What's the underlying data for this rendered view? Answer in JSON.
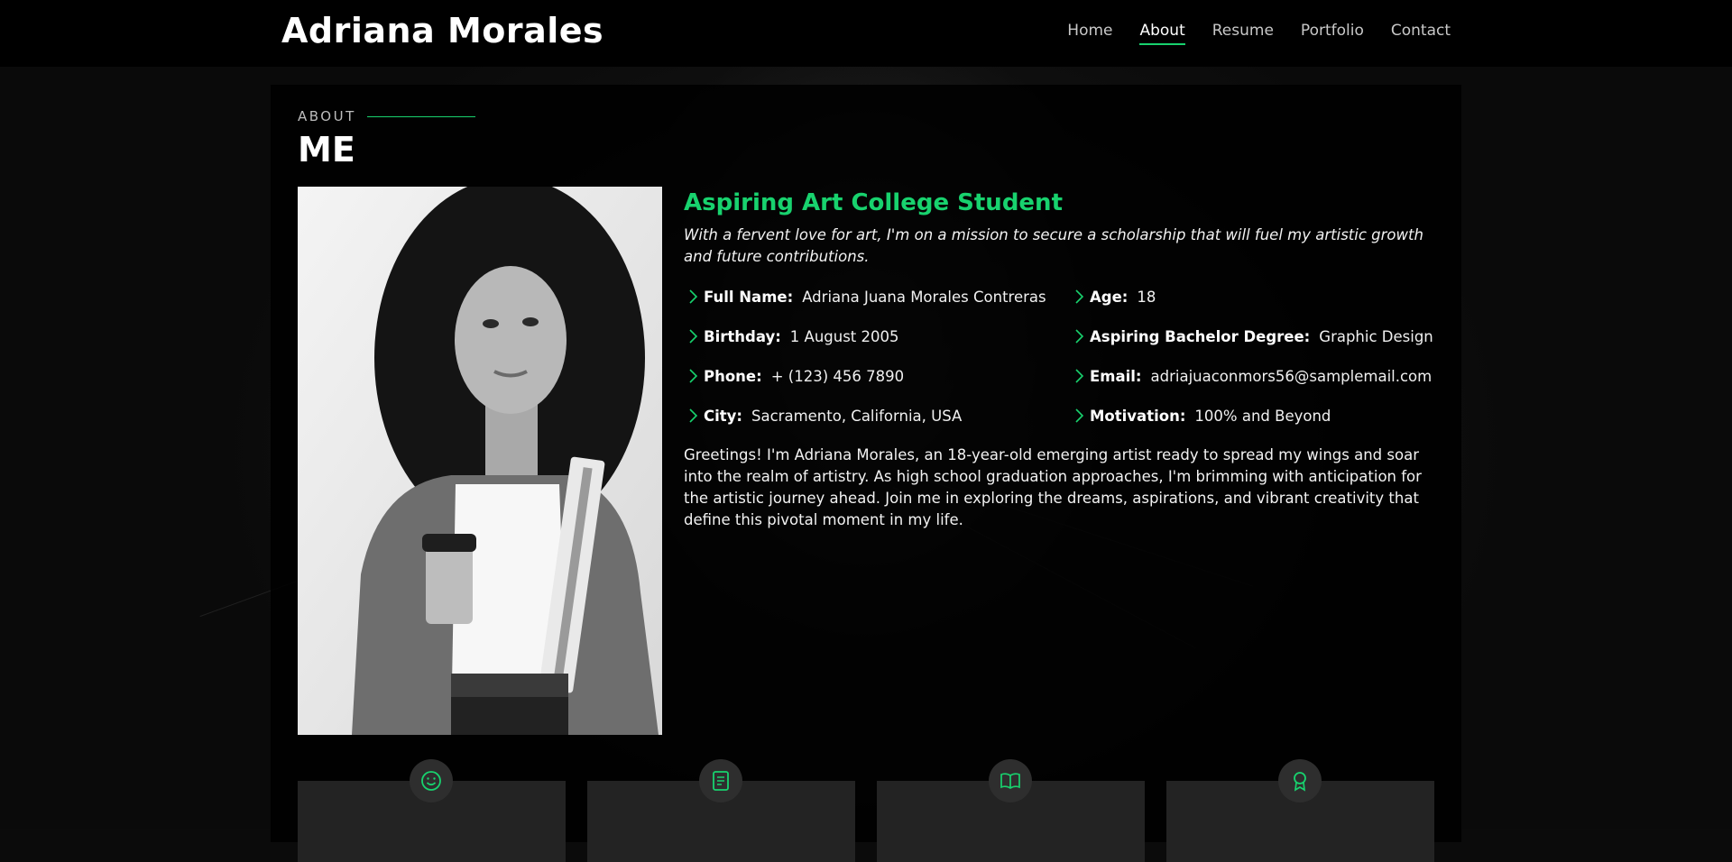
{
  "site": {
    "name": "Adriana Morales"
  },
  "nav": {
    "items": [
      {
        "label": "Home",
        "active": false
      },
      {
        "label": "About",
        "active": true
      },
      {
        "label": "Resume",
        "active": false
      },
      {
        "label": "Portfolio",
        "active": false
      },
      {
        "label": "Contact",
        "active": false
      }
    ]
  },
  "about": {
    "label": "ABOUT",
    "title": "ME",
    "heading": "Aspiring Art College Student",
    "intro": "With a fervent love for art, I'm on a mission to secure a scholarship that will fuel my artistic growth and future contributions.",
    "facts": [
      {
        "label": "Full Name:",
        "value": "Adriana Juana Morales Contreras"
      },
      {
        "label": "Age:",
        "value": "18"
      },
      {
        "label": "Birthday:",
        "value": "1 August 2005"
      },
      {
        "label": "Aspiring Bachelor Degree:",
        "value": "Graphic Design"
      },
      {
        "label": "Phone:",
        "value": "+ (123) 456 7890"
      },
      {
        "label": "Email:",
        "value": "adriajuaconmors56@samplemail.com"
      },
      {
        "label": "City:",
        "value": "Sacramento, California, USA"
      },
      {
        "label": "Motivation:",
        "value": "100% and Beyond"
      }
    ],
    "bio": "Greetings! I'm Adriana Morales, an 18-year-old emerging artist ready to spread my wings and soar into the realm of artistry. As high school graduation approaches, I'm brimming with anticipation for the artistic journey ahead. Join me in exploring the dreams, aspirations, and vibrant creativity that define this pivotal moment in my life."
  },
  "stats": [
    {
      "icon": "smile-icon"
    },
    {
      "icon": "journal-icon"
    },
    {
      "icon": "book-icon"
    },
    {
      "icon": "award-icon"
    }
  ],
  "colors": {
    "accent": "#18d26e",
    "background": "#000000",
    "stat_card": "#232323"
  }
}
